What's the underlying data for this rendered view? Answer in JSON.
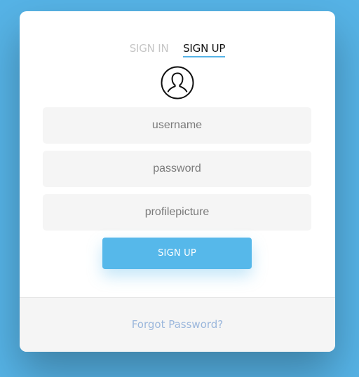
{
  "tabs": {
    "sign_in": "SIGN IN",
    "sign_up": "SIGN UP",
    "active": "SIGN UP"
  },
  "avatar_icon": "user-profile-icon",
  "form": {
    "username_placeholder": "username",
    "password_placeholder": "password",
    "profilepicture_placeholder": "profilepicture",
    "submit_label": "SIGN UP"
  },
  "footer": {
    "forgot_password": "Forgot Password?"
  },
  "colors": {
    "background": "#56b3e6",
    "accent": "#56b8ea",
    "link": "#9bb7dc",
    "field_bg": "#f5f5f5"
  }
}
